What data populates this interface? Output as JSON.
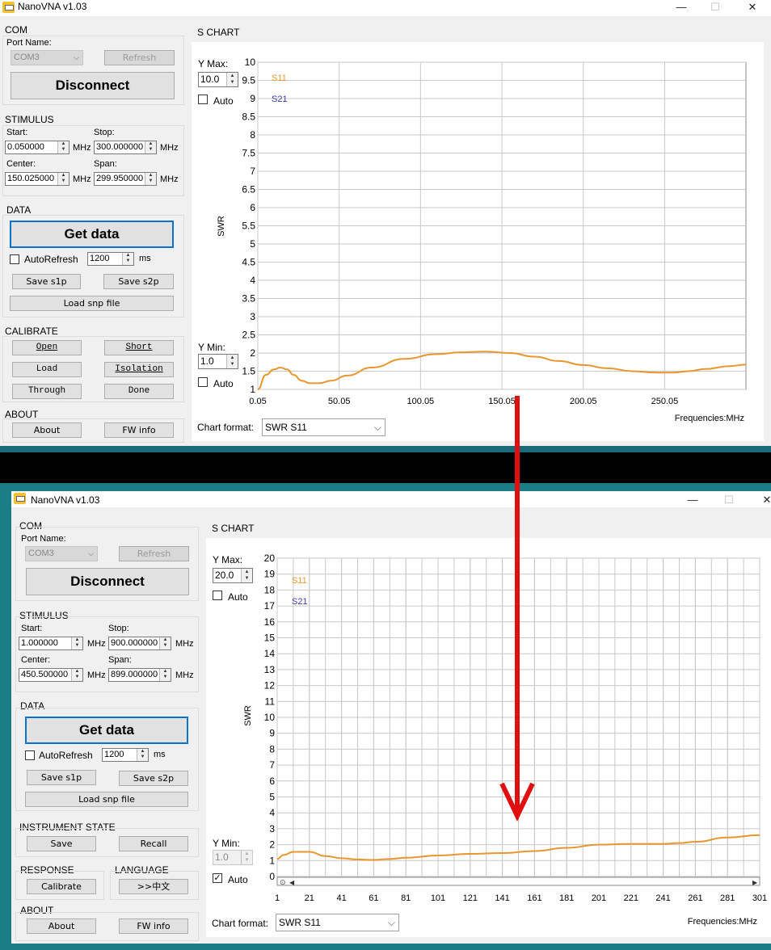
{
  "top_window": {
    "title": "NanoVNA v1.03",
    "window_controls": {
      "minimize": "—",
      "maximize": "☐",
      "close": "✕"
    },
    "com": {
      "group_label": "COM",
      "port_name_label": "Port Name:",
      "port_value": "COM3",
      "refresh_label": "Refresh",
      "disconnect_label": "Disconnect"
    },
    "stimulus": {
      "group_label": "STIMULUS",
      "start_label": "Start:",
      "start_value": "0.050000",
      "stop_label": "Stop:",
      "stop_value": "300.000000",
      "center_label": "Center:",
      "center_value": "150.025000",
      "span_label": "Span:",
      "span_value": "299.950000",
      "unit": "MHz"
    },
    "data": {
      "group_label": "DATA",
      "get_data_label": "Get data",
      "autorefresh_label": "AutoRefresh",
      "autorefresh_checked": false,
      "interval_value": "1200",
      "interval_unit": "ms",
      "save_s1p_label": "Save s1p",
      "save_s2p_label": "Save s2p",
      "load_snp_label": "Load snp file"
    },
    "calibrate": {
      "group_label": "CALIBRATE",
      "open_label": "Open",
      "short_label": "Short",
      "load_label": "Load",
      "isolation_label": "Isolation",
      "through_label": "Through",
      "done_label": "Done"
    },
    "about": {
      "group_label": "ABOUT",
      "about_label": "About",
      "fw_info_label": "FW info"
    },
    "chart_panel": {
      "section_label": "S CHART",
      "ymax_label": "Y Max:",
      "ymax_value": "10.0",
      "ymax_auto_label": "Auto",
      "ymax_auto_checked": false,
      "ymin_label": "Y Min:",
      "ymin_value": "1.0",
      "ymin_auto_label": "Auto",
      "ymin_auto_checked": false,
      "chart_format_label": "Chart format:",
      "chart_format_value": "SWR S11"
    }
  },
  "bottom_window": {
    "title": "NanoVNA v1.03",
    "window_controls": {
      "minimize": "—",
      "maximize": "☐",
      "close": "✕"
    },
    "com": {
      "group_label": "COM",
      "port_name_label": "Port Name:",
      "port_value": "COM3",
      "refresh_label": "Refresh",
      "disconnect_label": "Disconnect"
    },
    "stimulus": {
      "group_label": "STIMULUS",
      "start_label": "Start:",
      "start_value": "1.000000",
      "stop_label": "Stop:",
      "stop_value": "900.000000",
      "center_label": "Center:",
      "center_value": "450.500000",
      "span_label": "Span:",
      "span_value": "899.000000",
      "unit": "MHz"
    },
    "data": {
      "group_label": "DATA",
      "get_data_label": "Get data",
      "autorefresh_label": "AutoRefresh",
      "autorefresh_checked": false,
      "interval_value": "1200",
      "interval_unit": "ms",
      "save_s1p_label": "Save s1p",
      "save_s2p_label": "Save s2p",
      "load_snp_label": "Load snp file"
    },
    "instrument_state": {
      "group_label": "INSTRUMENT STATE",
      "save_label": "Save",
      "recall_label": "Recall"
    },
    "response": {
      "group_label": "RESPONSE",
      "calibrate_label": "Calibrate"
    },
    "language": {
      "group_label": "LANGUAGE",
      "lang_button_label": ">>中文"
    },
    "about": {
      "group_label": "ABOUT",
      "about_label": "About",
      "fw_info_label": "FW info"
    },
    "chart_panel": {
      "section_label": "S CHART",
      "ymax_label": "Y Max:",
      "ymax_value": "20.0",
      "ymax_auto_label": "Auto",
      "ymax_auto_checked": false,
      "ymin_label": "Y Min:",
      "ymin_value": "1.0",
      "ymin_auto_label": "Auto",
      "ymin_auto_checked": true,
      "chart_format_label": "Chart format:",
      "chart_format_value": "SWR S11"
    }
  },
  "colors": {
    "s11": "#e8962e",
    "s21": "#3a3aa0",
    "arrow": "#e01010",
    "grid": "#c8c8c8"
  },
  "chart_data": [
    {
      "type": "line",
      "title": "",
      "xlabel": "Frequencies:MHz",
      "ylabel": "SWR",
      "xlim": [
        0.05,
        300
      ],
      "ylim": [
        1,
        10
      ],
      "x_ticks": [
        "0.05",
        "50.05",
        "100.05",
        "150.05",
        "200.05",
        "250.05"
      ],
      "y_ticks": [
        "1",
        "1.5",
        "2",
        "2.5",
        "3",
        "3.5",
        "4",
        "4.5",
        "5",
        "5.5",
        "6",
        "6.5",
        "7",
        "7.5",
        "8",
        "8.5",
        "9",
        "9.5",
        "10"
      ],
      "legend": [
        "S11",
        "S21"
      ],
      "grid": true,
      "series": [
        {
          "name": "S11",
          "x": [
            0.05,
            5,
            10,
            14,
            18,
            22,
            27,
            32,
            38,
            45,
            55,
            70,
            90,
            110,
            125,
            140,
            155,
            170,
            185,
            200,
            215,
            230,
            245,
            255,
            265,
            275,
            290,
            300
          ],
          "y": [
            1.0,
            1.4,
            1.55,
            1.6,
            1.55,
            1.4,
            1.24,
            1.17,
            1.17,
            1.24,
            1.38,
            1.6,
            1.84,
            1.97,
            2.02,
            2.04,
            2.0,
            1.9,
            1.78,
            1.67,
            1.58,
            1.5,
            1.46,
            1.46,
            1.5,
            1.56,
            1.64,
            1.68
          ]
        }
      ]
    },
    {
      "type": "line",
      "title": "",
      "xlabel": "Frequencies:MHz",
      "ylabel": "SWR",
      "xlim": [
        1,
        301
      ],
      "ylim": [
        0,
        20
      ],
      "x_ticks": [
        "1",
        "21",
        "41",
        "61",
        "81",
        "101",
        "121",
        "141",
        "161",
        "181",
        "201",
        "221",
        "241",
        "261",
        "281",
        "301"
      ],
      "y_ticks": [
        "0",
        "1",
        "2",
        "3",
        "4",
        "5",
        "6",
        "7",
        "8",
        "9",
        "10",
        "11",
        "12",
        "13",
        "14",
        "15",
        "16",
        "17",
        "18",
        "19",
        "20"
      ],
      "legend": [
        "S11",
        "S21"
      ],
      "grid": true,
      "series": [
        {
          "name": "S11",
          "x": [
            1,
            5,
            11,
            21,
            31,
            41,
            51,
            61,
            71,
            81,
            101,
            121,
            141,
            161,
            181,
            201,
            221,
            241,
            251,
            261,
            281,
            301
          ],
          "y": [
            1.1,
            1.35,
            1.55,
            1.55,
            1.28,
            1.15,
            1.07,
            1.04,
            1.1,
            1.18,
            1.32,
            1.42,
            1.47,
            1.6,
            1.8,
            2.0,
            2.05,
            2.05,
            2.1,
            2.18,
            2.45,
            2.6
          ]
        }
      ]
    }
  ]
}
